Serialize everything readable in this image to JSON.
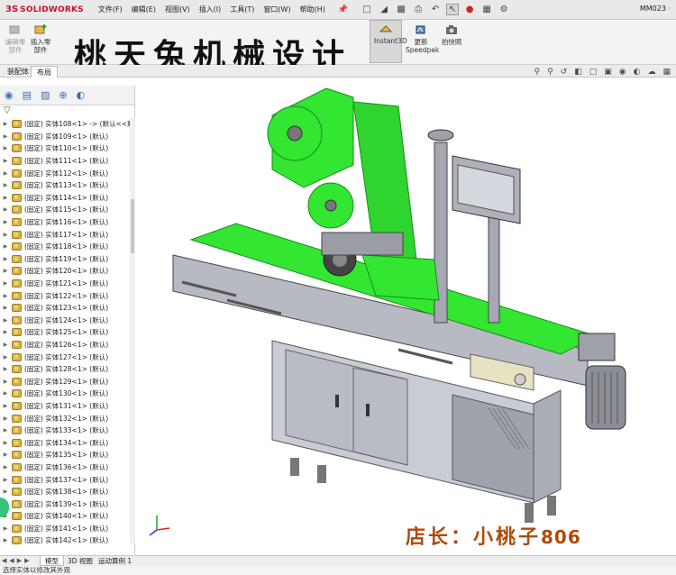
{
  "menubar": {
    "logo_prefix": "3S",
    "logo_brand_a": "SOLID",
    "logo_brand_b": "WORKS",
    "items": [
      "文件(F)",
      "编辑(E)",
      "视图(V)",
      "插入(I)",
      "工具(T)",
      "窗口(W)",
      "帮助(H)"
    ],
    "doc_title": "MM023 ·"
  },
  "ribbon": {
    "edit_part_label": "编辑零\n部件",
    "insert_part_label": "插入零\n部件",
    "instant3d_label": "Instant3D",
    "speedpak_label": "更新\nSpeedpak",
    "snapshot_label": "拍快照"
  },
  "tabs": {
    "assembly": "装配体",
    "layout": "布局"
  },
  "headline": "桃天兔机械设计",
  "tree": {
    "nodes": [
      "(固定) 实体108<1> -> (默认<<默",
      "(固定) 实体109<1> (默认)",
      "(固定) 实体110<1> (默认)",
      "(固定) 实体111<1> (默认)",
      "(固定) 实体112<1> (默认)",
      "(固定) 实体113<1> (默认)",
      "(固定) 实体114<1> (默认)",
      "(固定) 实体115<1> (默认)",
      "(固定) 实体116<1> (默认)",
      "(固定) 实体117<1> (默认)",
      "(固定) 实体118<1> (默认)",
      "(固定) 实体119<1> (默认)",
      "(固定) 实体120<1> (默认)",
      "(固定) 实体121<1> (默认)",
      "(固定) 实体122<1> (默认)",
      "(固定) 实体123<1> (默认)",
      "(固定) 实体124<1> (默认)",
      "(固定) 实体125<1> (默认)",
      "(固定) 实体126<1> (默认)",
      "(固定) 实体127<1> (默认)",
      "(固定) 实体128<1> (默认)",
      "(固定) 实体129<1> (默认)",
      "(固定) 实体130<1> (默认)",
      "(固定) 实体131<1> (默认)",
      "(固定) 实体132<1> (默认)",
      "(固定) 实体133<1> (默认)",
      "(固定) 实体134<1> (默认)",
      "(固定) 实体135<1> (默认)",
      "(固定) 实体136<1> (默认)",
      "(固定) 实体137<1> (默认)",
      "(固定) 实体138<1> (默认)",
      "(固定) 实体139<1> (默认)",
      "(固定) 实体140<1> (默认)",
      "(固定) 实体141<1> (默认)",
      "(固定) 实体142<1> (默认)"
    ]
  },
  "shop": {
    "label": "店长：小桃子",
    "number": "806"
  },
  "bottom_tabs": {
    "model": "模型",
    "view3d": "3D 视图",
    "motion": "运动算例 1"
  },
  "status": "选择实体以修改其外观",
  "colors": {
    "machine_green": "#32e632",
    "menubar": "#e9e9e9",
    "brand_red": "#c8102e"
  }
}
